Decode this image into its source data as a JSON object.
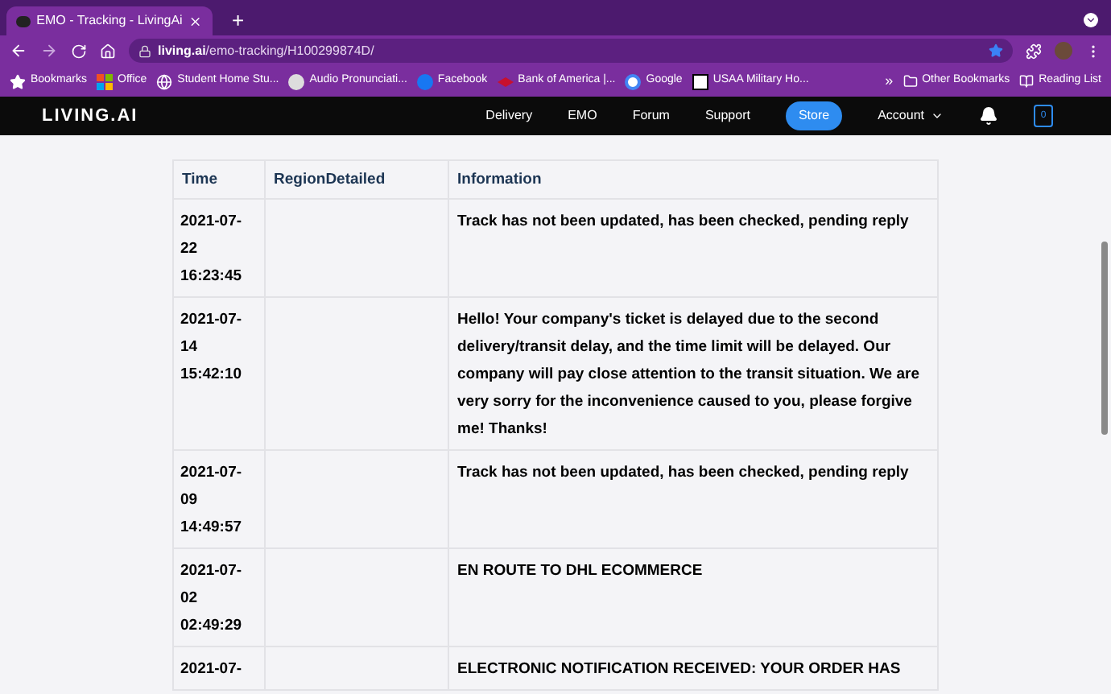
{
  "browser": {
    "tab_title": "EMO - Tracking - LivingAi",
    "new_tab": "+",
    "url_host": "living.ai",
    "url_path": "/emo-tracking/H100299874D/",
    "bookmarks": [
      {
        "label": "Bookmarks",
        "kind": "star"
      },
      {
        "label": "Office",
        "kind": "office"
      },
      {
        "label": "Student Home Stu...",
        "kind": "globe"
      },
      {
        "label": "Audio Pronunciati...",
        "kind": "audio"
      },
      {
        "label": "Facebook",
        "kind": "facebook"
      },
      {
        "label": "Bank of America |...",
        "kind": "bank"
      },
      {
        "label": "Google",
        "kind": "google"
      },
      {
        "label": "USAA Military Ho...",
        "kind": "usaa"
      }
    ],
    "more": "»",
    "other_bookmarks": "Other Bookmarks",
    "reading_list": "Reading List"
  },
  "site_nav": {
    "logo": "LIVING.AI",
    "links": [
      {
        "label": "Delivery",
        "selected": false
      },
      {
        "label": "EMO",
        "selected": false
      },
      {
        "label": "Forum",
        "selected": false
      },
      {
        "label": "Support",
        "selected": false
      },
      {
        "label": "Store",
        "selected": true
      },
      {
        "label": "Account",
        "selected": false
      }
    ],
    "cart_count": "0"
  },
  "table": {
    "columns": [
      "Time",
      "RegionDetailed",
      "Information"
    ],
    "rows": [
      {
        "time": "2021-07-22 16:23:45",
        "region": "",
        "information": "Track has not been updated, has been checked, pending reply"
      },
      {
        "time": "2021-07-14 15:42:10",
        "region": "",
        "information": "Hello! Your company's ticket is delayed due to the second delivery/transit delay, and the time limit will be delayed. Our company will pay close attention to the transit situation. We are very sorry for the inconvenience caused to you, please forgive me! Thanks!"
      },
      {
        "time": "2021-07-09 14:49:57",
        "region": "",
        "information": "Track has not been updated, has been checked, pending reply"
      },
      {
        "time": "2021-07-02 02:49:29",
        "region": "",
        "information": "EN ROUTE TO DHL ECOMMERCE"
      },
      {
        "time": "2021-07-",
        "region": "",
        "information": "ELECTRONIC NOTIFICATION RECEIVED: YOUR ORDER HAS"
      }
    ]
  }
}
